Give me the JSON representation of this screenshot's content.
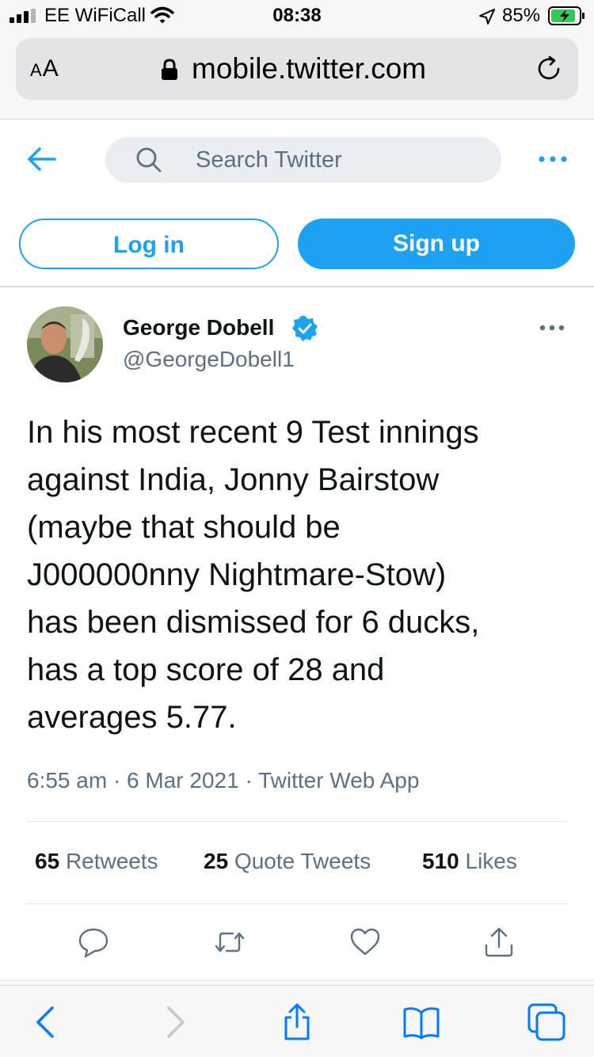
{
  "status_bar": {
    "carrier": "EE WiFiCall",
    "time": "08:38",
    "battery_percent": "85%"
  },
  "browser": {
    "text_size_label_small": "A",
    "text_size_label_large": "A",
    "url": "mobile.twitter.com"
  },
  "header": {
    "search_placeholder": "Search Twitter"
  },
  "auth": {
    "login_label": "Log in",
    "signup_label": "Sign up"
  },
  "tweet": {
    "author_name": "George Dobell",
    "author_handle": "@GeorgeDobell1",
    "verified": true,
    "text": "In his most recent 9 Test innings\nagainst India, Jonny Bairstow\n(maybe that should be\nJ000000nny Nightmare-Stow)\nhas been dismissed for 6 ducks,\nhas a top score of 28 and\naverages 5.77.",
    "meta": "6:55 am · 6 Mar 2021 · Twitter Web App",
    "retweets_count": "65",
    "retweets_label": "Retweets",
    "quotes_count": "25",
    "quotes_label": "Quote Tweets",
    "likes_count": "510",
    "likes_label": "Likes"
  },
  "colors": {
    "twitter_blue": "#1da1f2",
    "secondary_text": "#5b7083",
    "ios_blue": "#007aff",
    "battery_green": "#34c759"
  },
  "icons": {
    "status": [
      "signal-icon",
      "wifi-icon",
      "location-icon",
      "battery-icon"
    ],
    "header": [
      "back-arrow-icon",
      "search-icon",
      "more-icon"
    ],
    "tweet_actions": [
      "reply-icon",
      "retweet-icon",
      "like-icon",
      "share-icon"
    ],
    "browser_toolbar": [
      "back-icon",
      "forward-icon",
      "share-icon",
      "bookmarks-icon",
      "tabs-icon"
    ]
  }
}
